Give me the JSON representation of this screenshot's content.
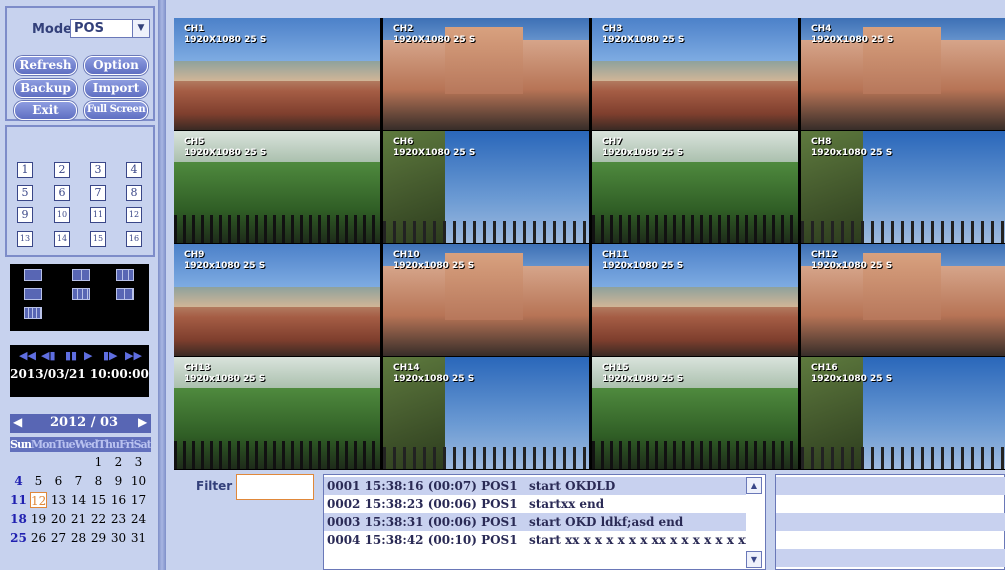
{
  "mode": {
    "label": "Mode",
    "value": "POS"
  },
  "buttons": {
    "refresh": "Refresh",
    "option": "Option",
    "backup": "Backup",
    "import": "Import",
    "exit": "Exit",
    "fullscreen": "Full Screen"
  },
  "channel_buttons": [
    "1",
    "2",
    "3",
    "4",
    "5",
    "6",
    "7",
    "8",
    "9",
    "10",
    "11",
    "12",
    "13",
    "14",
    "15",
    "16"
  ],
  "layout_icons": [
    "layout-1x1-icon",
    "layout-2x2-icon",
    "layout-3x3-icon",
    "layout-1plus5-icon",
    "layout-1plus7-icon",
    "layout-2plus8-icon",
    "layout-4x4-icon"
  ],
  "playback": {
    "controls": [
      "rewind-fast-icon",
      "step-back-icon",
      "pause-icon",
      "play-icon",
      "step-forward-icon",
      "forward-fast-icon"
    ],
    "datetime": "2013/03/21 10:00:00"
  },
  "calendar": {
    "title": "2012 / 03",
    "weekdays": [
      "Sun",
      "Mon",
      "Tue",
      "Wed",
      "Thu",
      "Fri",
      "Sat"
    ],
    "days": [
      [
        "",
        "",
        "",
        "",
        "1",
        "2",
        "3"
      ],
      [
        "4",
        "5",
        "6",
        "7",
        "8",
        "9",
        "10"
      ],
      [
        "11",
        "12",
        "13",
        "14",
        "15",
        "16",
        "17"
      ],
      [
        "18",
        "19",
        "20",
        "21",
        "22",
        "23",
        "24"
      ],
      [
        "25",
        "26",
        "27",
        "28",
        "29",
        "30",
        "31"
      ]
    ],
    "selected": "12"
  },
  "cameras": [
    {
      "name": "CH1",
      "res": "1920X1080 25 S"
    },
    {
      "name": "CH2",
      "res": "1920X1080 25 S"
    },
    {
      "name": "CH3",
      "res": "1920X1080 25 S"
    },
    {
      "name": "CH4",
      "res": "1920X1080 25 S"
    },
    {
      "name": "CH5",
      "res": "1920X1080 25 S"
    },
    {
      "name": "CH6",
      "res": "1920X1080 25 S"
    },
    {
      "name": "CH7",
      "res": "1920x1080 25 S"
    },
    {
      "name": "CH8",
      "res": "1920x1080 25 S"
    },
    {
      "name": "CH9",
      "res": "1920x1080 25 S"
    },
    {
      "name": "CH10",
      "res": "1920x1080 25 S"
    },
    {
      "name": "CH11",
      "res": "1920x1080 25 S"
    },
    {
      "name": "CH12",
      "res": "1920x1080 25 S"
    },
    {
      "name": "CH13",
      "res": "1920x1080 25 S"
    },
    {
      "name": "CH14",
      "res": "1920x1080 25 S"
    },
    {
      "name": "CH15",
      "res": "1920x1080 25 S"
    },
    {
      "name": "CH16",
      "res": "1920x1080 25 S"
    }
  ],
  "filter": {
    "label": "Filter",
    "value": ""
  },
  "pos_entries": [
    {
      "info": "0001 15:38:16 (00:07) POS1",
      "text": "start OKDLD"
    },
    {
      "info": "0002 15:38:23 (00:06) POS1",
      "text": "startxx end"
    },
    {
      "info": "0003 15:38:31 (00:06) POS1",
      "text": "start OKD ldkf;asd end"
    },
    {
      "info": "0004 15:38:42 (00:10) POS1",
      "text": "start xx x x x x x x xx x x x x x x xx"
    }
  ]
}
